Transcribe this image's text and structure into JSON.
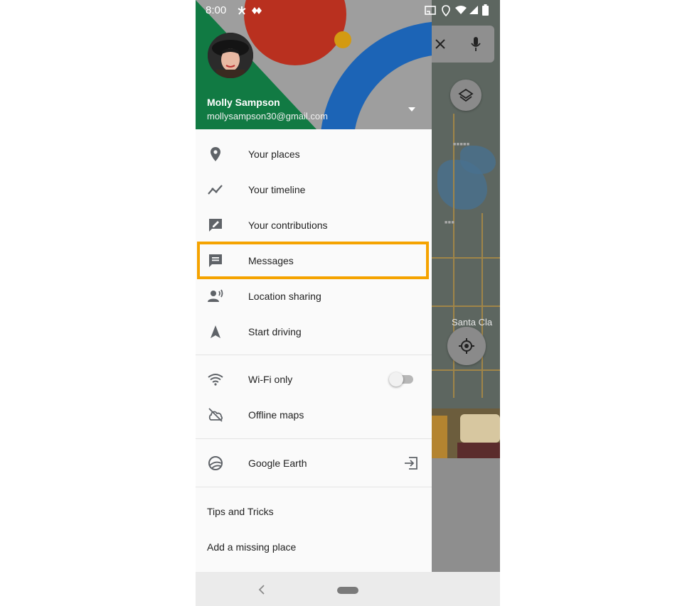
{
  "status_bar": {
    "time": "8:00"
  },
  "account": {
    "name": "Molly Sampson",
    "email": "mollysampson30@gmail.com"
  },
  "menu": {
    "group1": [
      {
        "label": "Your places",
        "icon": "location-pin-icon"
      },
      {
        "label": "Your timeline",
        "icon": "timeline-icon"
      },
      {
        "label": "Your contributions",
        "icon": "contributions-icon"
      },
      {
        "label": "Messages",
        "icon": "message-icon"
      },
      {
        "label": "Location sharing",
        "icon": "location-sharing-icon"
      },
      {
        "label": "Start driving",
        "icon": "navigation-arrow-icon"
      }
    ],
    "group2": [
      {
        "label": "Wi-Fi only",
        "icon": "wifi-icon"
      },
      {
        "label": "Offline maps",
        "icon": "cloud-off-icon"
      }
    ],
    "group3": [
      {
        "label": "Google Earth",
        "icon": "earth-icon"
      }
    ],
    "group4": [
      {
        "label": "Tips and Tricks"
      },
      {
        "label": "Add a missing place"
      }
    ]
  },
  "wifi_only_enabled": false,
  "highlighted_item": "Messages",
  "map": {
    "labels": {
      "city": "Santa Cla"
    }
  },
  "colors": {
    "highlight": "#f5a300",
    "header_green": "#117a43",
    "header_red": "#b9301f",
    "header_blue": "#1c64b6"
  }
}
